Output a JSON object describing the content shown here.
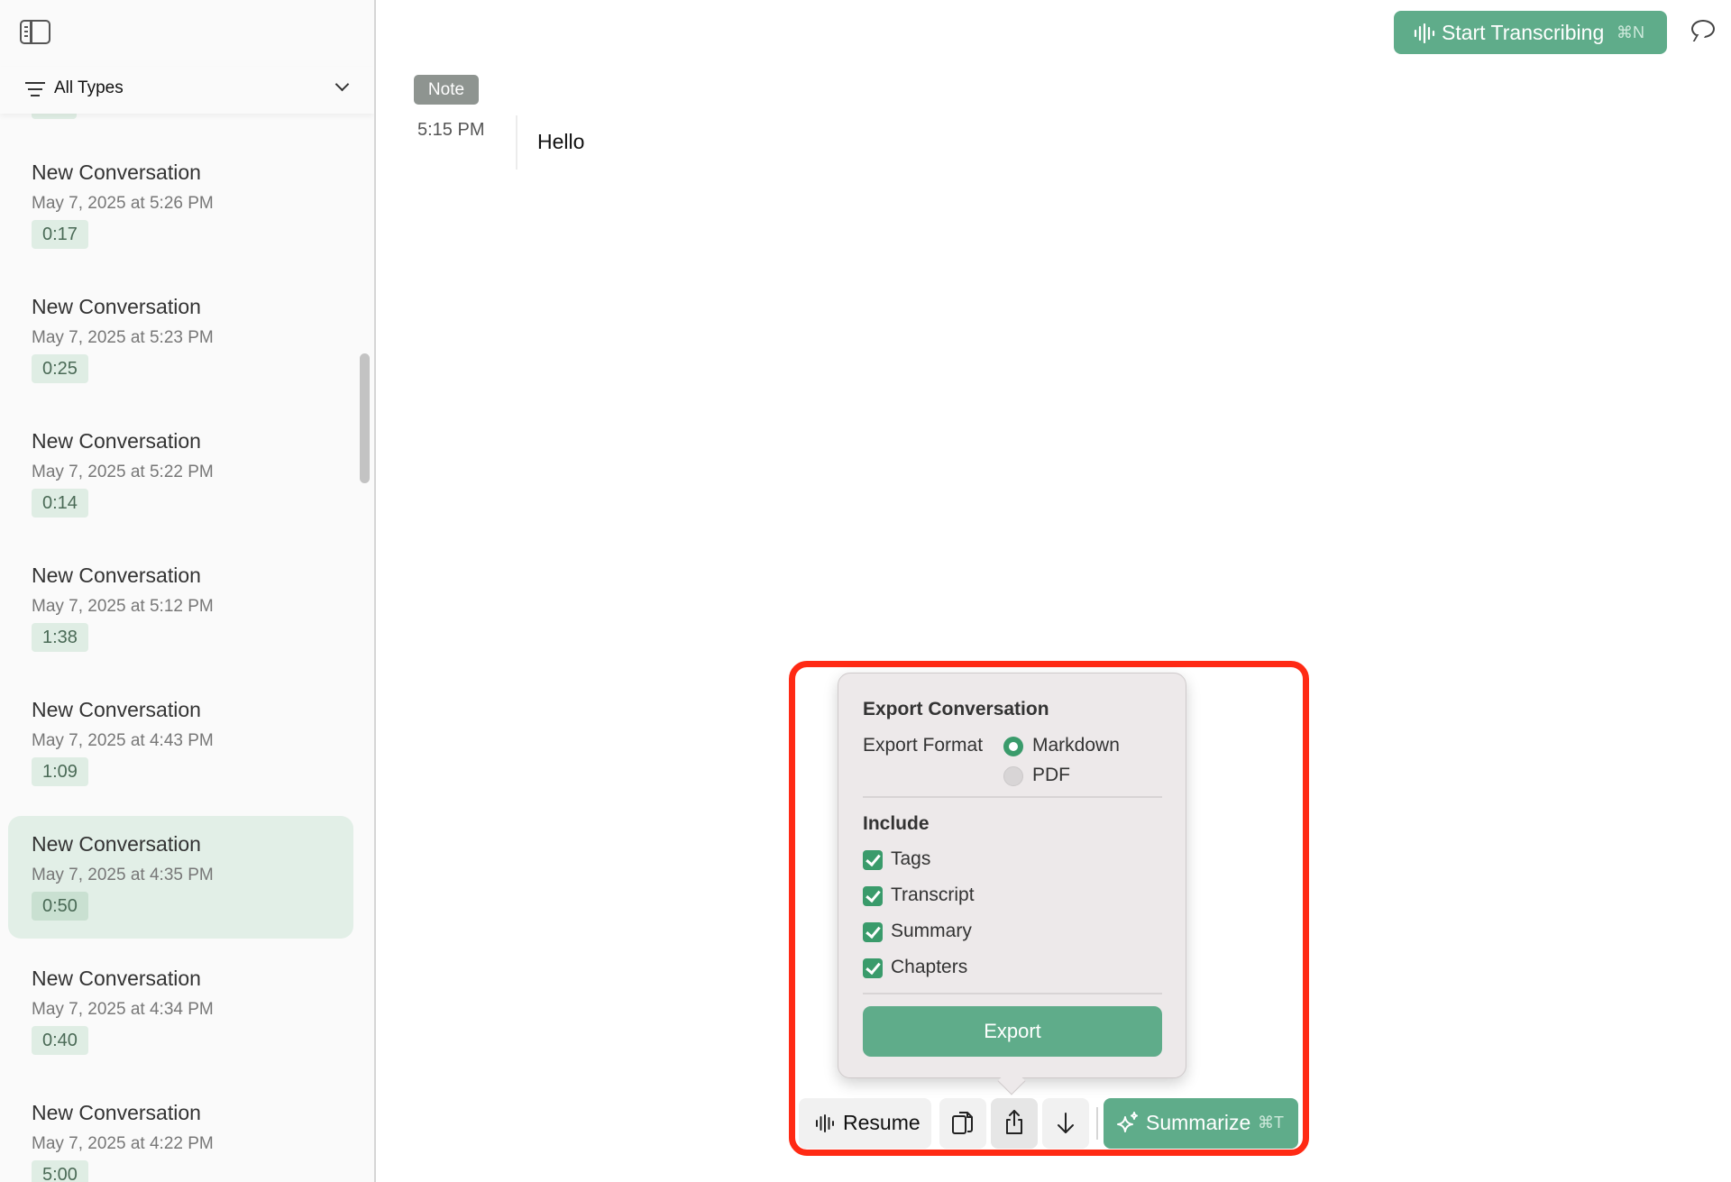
{
  "sidebar": {
    "filter_label": "All Types",
    "conversations": [
      {
        "title": "New Conversation",
        "date": "May 7, 2025 at 5:26 PM",
        "duration": "0:17",
        "selected": false
      },
      {
        "title": "New Conversation",
        "date": "May 7, 2025 at 5:23 PM",
        "duration": "0:25",
        "selected": false
      },
      {
        "title": "New Conversation",
        "date": "May 7, 2025 at 5:22 PM",
        "duration": "0:14",
        "selected": false
      },
      {
        "title": "New Conversation",
        "date": "May 7, 2025 at 5:12 PM",
        "duration": "1:38",
        "selected": false
      },
      {
        "title": "New Conversation",
        "date": "May 7, 2025 at 4:43 PM",
        "duration": "1:09",
        "selected": false
      },
      {
        "title": "New Conversation",
        "date": "May 7, 2025 at 4:35 PM",
        "duration": "0:50",
        "selected": true
      },
      {
        "title": "New Conversation",
        "date": "May 7, 2025 at 4:34 PM",
        "duration": "0:40",
        "selected": false
      },
      {
        "title": "New Conversation",
        "date": "May 7, 2025 at 4:22 PM",
        "duration": "5:00",
        "selected": false
      }
    ]
  },
  "header": {
    "start_label": "Start Transcribing",
    "start_shortcut": "⌘N"
  },
  "main": {
    "note_badge": "Note",
    "message_time": "5:15 PM",
    "message_text": "Hello"
  },
  "export_popover": {
    "title": "Export Conversation",
    "format_label": "Export Format",
    "formats": [
      {
        "label": "Markdown",
        "selected": true
      },
      {
        "label": "PDF",
        "selected": false
      }
    ],
    "include_title": "Include",
    "include_items": [
      {
        "label": "Tags",
        "checked": true
      },
      {
        "label": "Transcript",
        "checked": true
      },
      {
        "label": "Summary",
        "checked": true
      },
      {
        "label": "Chapters",
        "checked": true
      }
    ],
    "export_button": "Export"
  },
  "toolbar": {
    "resume_label": "Resume",
    "summarize_label": "Summarize",
    "summarize_shortcut": "⌘T"
  },
  "colors": {
    "accent_green": "#5fac8a",
    "highlight_red": "#ff2a14",
    "selected_row": "#e2efe7"
  }
}
